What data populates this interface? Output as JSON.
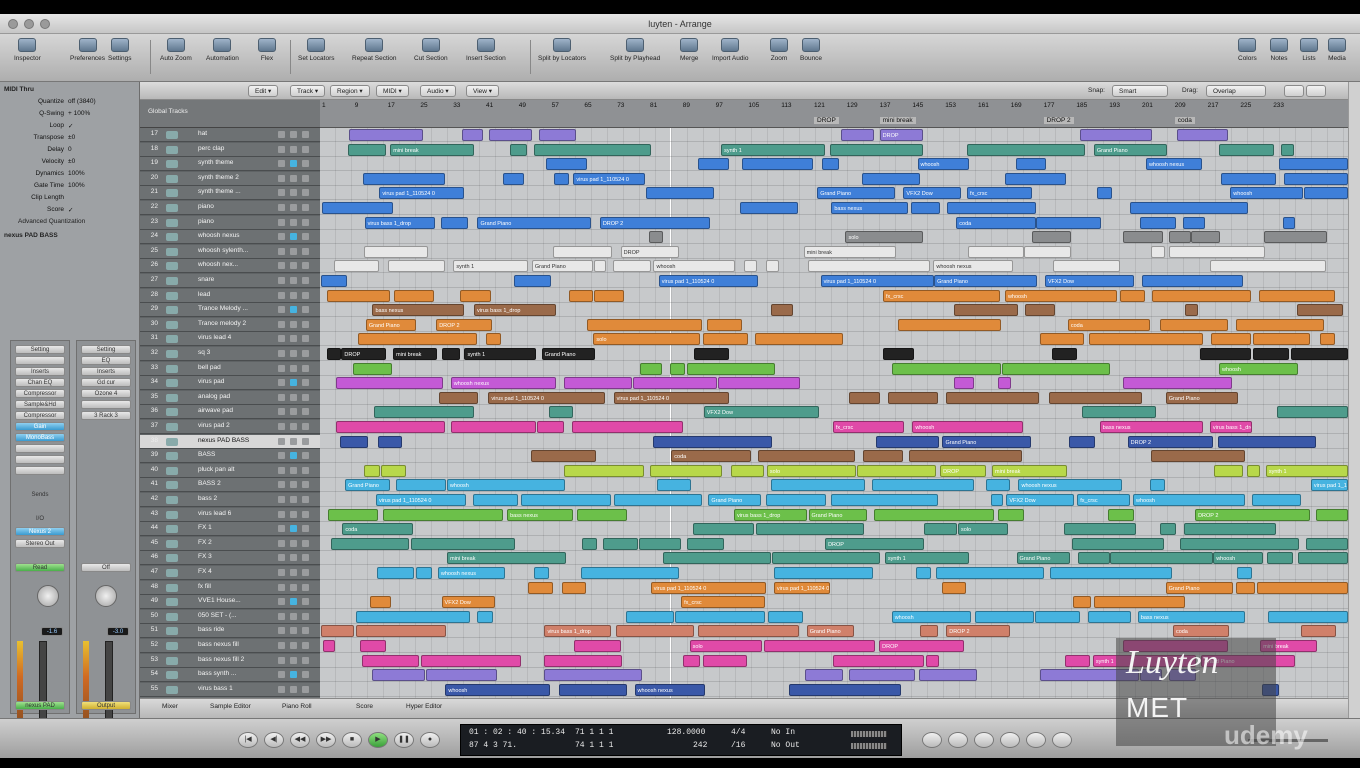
{
  "window": {
    "title": "luyten - Arrange"
  },
  "toolbar": {
    "left": [
      "Inspector",
      "Preferences",
      "Settings"
    ],
    "mid": [
      "Auto Zoom",
      "Automation",
      "Flex",
      "Set Locators",
      "Repeat Section",
      "Cut Section",
      "Insert Section",
      "Split by Locators",
      "Split by Playhead",
      "Merge",
      "Import Audio",
      "Zoom",
      "Bounce"
    ],
    "right": [
      "Colors",
      "Notes",
      "Lists",
      "Media"
    ]
  },
  "inspector": {
    "region_header": "MIDI Thru",
    "params": [
      {
        "label": "Quantize",
        "value": "off (3840)"
      },
      {
        "label": "Q-Swing",
        "value": "+ 100%"
      },
      {
        "label": "Loop",
        "value": "✓"
      },
      {
        "label": "Transpose",
        "value": "±0"
      },
      {
        "label": "Delay",
        "value": "0"
      },
      {
        "label": "Velocity",
        "value": "±0"
      },
      {
        "label": "Dynamics",
        "value": "100%"
      },
      {
        "label": "Gate Time",
        "value": "100%"
      },
      {
        "label": "Clip Length",
        "value": ""
      },
      {
        "label": "Score",
        "value": "✓"
      }
    ],
    "advanced": "Advanced Quantization",
    "track_header": "nexus PAD BASS",
    "left_strip": {
      "buttons": [
        "Setting",
        "",
        "Inserts",
        "Chan EQ",
        "Compressor",
        "Sample&Hd",
        "Compressor",
        "Gain",
        "MonoBass",
        "",
        "",
        ""
      ],
      "sends": "Sends",
      "io": "I/O",
      "input": "Nexus 2",
      "output": "Stereo Out",
      "mode": "Read",
      "gain": "-1.6",
      "name": "nexus PAD"
    },
    "right_strip": {
      "buttons": [
        "Setting",
        "EQ",
        "Inserts",
        "Gd cur",
        "Ozone 4",
        "",
        "3 Rack 3"
      ],
      "mode": "Off",
      "gain": "-3.0",
      "name": "Output"
    }
  },
  "arrange": {
    "menus": [
      "Edit",
      "Track",
      "Region",
      "MIDI",
      "Audio",
      "View"
    ],
    "snap_label": "Snap:",
    "snap": "Smart",
    "drag_label": "Drag:",
    "drag": "Overlap",
    "global_tracks": "Global Tracks"
  },
  "ruler": {
    "bars": [
      "1",
      "9",
      "17",
      "25",
      "33",
      "41",
      "49",
      "57",
      "65",
      "73",
      "81",
      "89",
      "97",
      "105",
      "113",
      "121",
      "129",
      "137",
      "145",
      "153",
      "161",
      "169",
      "177",
      "185",
      "193",
      "201",
      "209",
      "217",
      "225",
      "233"
    ],
    "markers": [
      {
        "text": "DROP",
        "bar": 121
      },
      {
        "text": "mini break",
        "bar": 137
      },
      {
        "text": "DROP 2",
        "bar": 177
      },
      {
        "text": "coda",
        "bar": 209
      }
    ]
  },
  "tracks": [
    {
      "num": "17",
      "name": "hat"
    },
    {
      "num": "18",
      "name": "perc clap"
    },
    {
      "num": "19",
      "name": "synth theme"
    },
    {
      "num": "20",
      "name": "synth theme 2"
    },
    {
      "num": "21",
      "name": "synth theme ..."
    },
    {
      "num": "22",
      "name": "piano"
    },
    {
      "num": "23",
      "name": "piano"
    },
    {
      "num": "24",
      "name": "whoosh nexus"
    },
    {
      "num": "25",
      "name": "whoosh sylenth..."
    },
    {
      "num": "26",
      "name": "whoosh nex..."
    },
    {
      "num": "27",
      "name": "snare"
    },
    {
      "num": "28",
      "name": "lead"
    },
    {
      "num": "29",
      "name": "Trance Melody ..."
    },
    {
      "num": "30",
      "name": "Trance melody 2"
    },
    {
      "num": "31",
      "name": "virus lead 4"
    },
    {
      "num": "32",
      "name": "sq 3"
    },
    {
      "num": "33",
      "name": "bell pad"
    },
    {
      "num": "34",
      "name": "virus pad"
    },
    {
      "num": "35",
      "name": "analog pad"
    },
    {
      "num": "36",
      "name": "airwave pad"
    },
    {
      "num": "37",
      "name": "virus pad 2"
    },
    {
      "num": "38",
      "name": "nexus PAD BASS"
    },
    {
      "num": "39",
      "name": "BASS"
    },
    {
      "num": "40",
      "name": "pluck pan alt"
    },
    {
      "num": "41",
      "name": "BASS 2"
    },
    {
      "num": "42",
      "name": "bass 2"
    },
    {
      "num": "43",
      "name": "virus lead 6"
    },
    {
      "num": "44",
      "name": "FX 1"
    },
    {
      "num": "45",
      "name": "FX 2"
    },
    {
      "num": "46",
      "name": "FX 3"
    },
    {
      "num": "47",
      "name": "FX 4"
    },
    {
      "num": "48",
      "name": "fx fill"
    },
    {
      "num": "49",
      "name": "VVE1 House..."
    },
    {
      "num": "50",
      "name": "050 SET - (..."
    },
    {
      "num": "51",
      "name": "bass ride"
    },
    {
      "num": "52",
      "name": "bass nexus fill"
    },
    {
      "num": "53",
      "name": "bass nexus fill 2"
    },
    {
      "num": "54",
      "name": "bass synth ..."
    },
    {
      "num": "55",
      "name": "virus bass 1"
    },
    {
      "num": "56",
      "name": ""
    }
  ],
  "colors": {
    "purple": "#8d7ad6",
    "teal": "#4e9c8c",
    "blue": "#3f7fd8",
    "lightblue": "#46b3e0",
    "orange": "#e08a3a",
    "brown": "#9a6a4a",
    "green": "#6cc04a",
    "lime": "#b8d84a",
    "magenta": "#c45ad6",
    "pink": "#e04aa8",
    "grayregion": "#8a8c8e",
    "white": "#e8e8e8",
    "darkblue": "#3a58a8",
    "salmon": "#d0806a"
  },
  "region_labels": [
    "DROP",
    "mini break",
    "synth 1",
    "Grand Piano",
    "whoosh",
    "whoosh nexus",
    "virus pad 1_110524 0",
    "virus pad 1_110524 0",
    "Grand Piano",
    "VFX2 Dow",
    "fx_crsc",
    "whoosh",
    "bass nexus",
    "virus bass 1_drop",
    "Grand Piano",
    "DROP 2",
    "coda",
    "solo"
  ],
  "bottom_tabs": [
    "Mixer",
    "Sample Editor",
    "Piano Roll",
    "Score",
    "Hyper Editor"
  ],
  "transport": {
    "smpte": "01 : 02 : 40 : 15.34",
    "smpte2": "87  4  3  71.",
    "bars": "71   1   1   1",
    "bars2": "74   1   1   1",
    "tempo": "128.0000",
    "tempo2": "242",
    "sig": "4/4",
    "div": "/16",
    "in": "No In",
    "out": "No Out"
  },
  "overlay": {
    "line1": "Luyten",
    "line2": "MET",
    "watermark": "udemy"
  }
}
